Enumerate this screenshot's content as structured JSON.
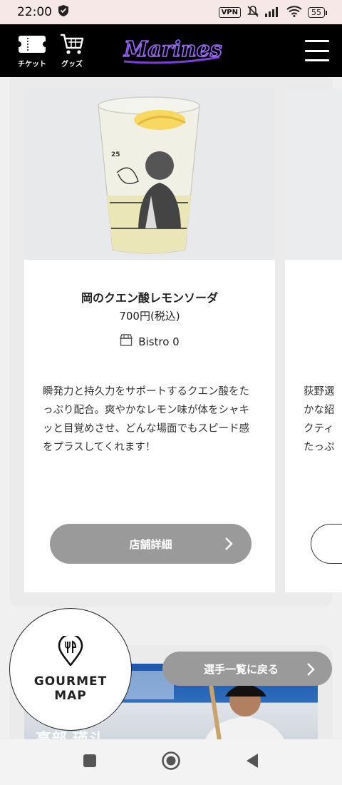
{
  "status": {
    "time": "22:00",
    "vpn": "VPN",
    "battery": "55"
  },
  "header": {
    "ticket_label": "チケット",
    "goods_label": "グッズ",
    "logo_text": "Marines"
  },
  "card": {
    "name": "岡のクエン酸レモンソーダ",
    "price": "700円(税込)",
    "shop": "Bistro 0",
    "description": "瞬発力と持久力をサポートするクエン酸をたっぷり配合。爽やかなレモン味が体をシャキッと目覚めさせ、どんな場面でもスピード感をプラスしてくれます！",
    "detail_button": "店舗詳細",
    "cup_number": "25"
  },
  "next_card": {
    "desc_lines": [
      "荻野選",
      "かな紹",
      "クティ",
      "たっぷ"
    ]
  },
  "gourmet_map": {
    "line1": "GOURMET",
    "line2": "MAP"
  },
  "back_button": "選手一覧に戻る",
  "lower_photo_label": "高部 瑛斗"
}
